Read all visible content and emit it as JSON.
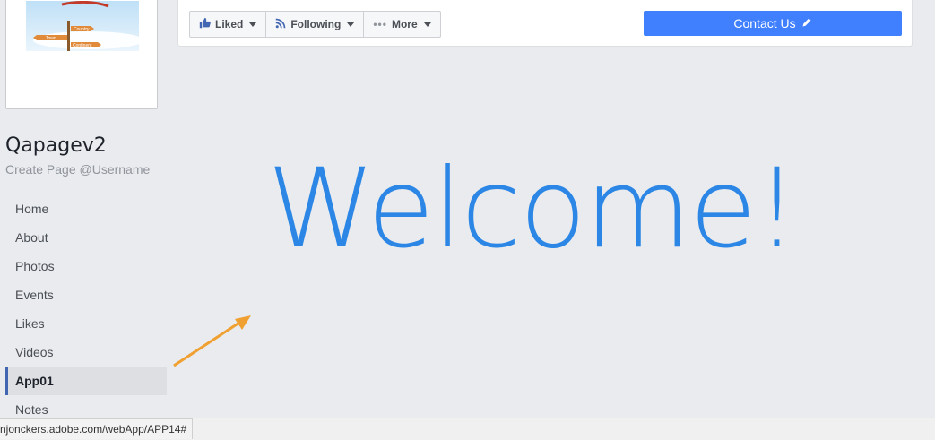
{
  "page": {
    "name": "Qapagev2",
    "username": "Create Page @Username"
  },
  "profile_sign": {
    "country": "Country",
    "town": "Town",
    "continent": "Continent"
  },
  "action_bar": {
    "liked_label": "Liked",
    "following_label": "Following",
    "more_label": "More",
    "contact_label": "Contact Us"
  },
  "nav": {
    "items": [
      {
        "label": "Home"
      },
      {
        "label": "About"
      },
      {
        "label": "Photos"
      },
      {
        "label": "Events"
      },
      {
        "label": "Likes"
      },
      {
        "label": "Videos"
      },
      {
        "label": "App01",
        "active": true
      },
      {
        "label": "Notes"
      }
    ]
  },
  "main": {
    "welcome_text": "Welcome!"
  },
  "status_bar": {
    "url": "njonckers.adobe.com/webApp/APP14#"
  },
  "colors": {
    "accent": "#4080ff",
    "welcome": "#2b86e5",
    "arrow": "#f0a030",
    "active_indicator": "#4267b2"
  }
}
